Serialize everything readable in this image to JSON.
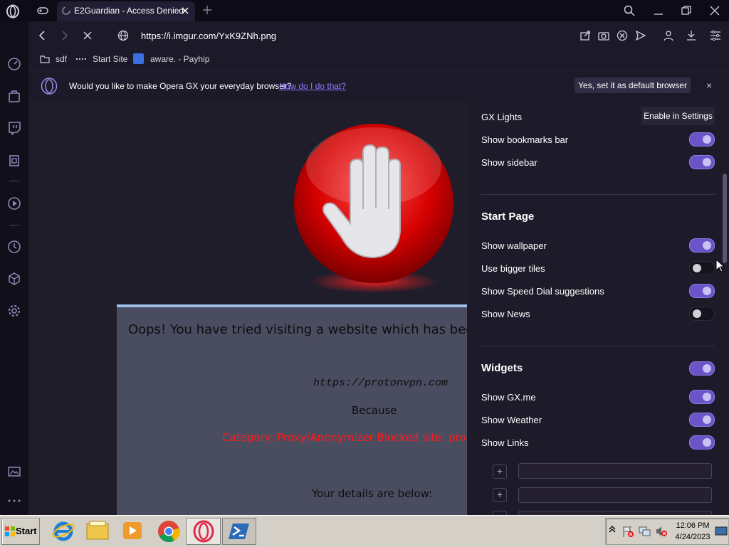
{
  "tab": {
    "title": "E2Guardian - Access Denied"
  },
  "address_bar": {
    "url": "https://i.imgur.com/YxK9ZNh.png"
  },
  "bookmarks": [
    "sdf",
    "Start Site",
    "aware. - Payhip"
  ],
  "infobar": {
    "message": "Would you like to make Opera GX your everyday browser?",
    "link": "How do I do that?",
    "button": "Yes, set it as default browser",
    "close": "×"
  },
  "page": {
    "title": "Oops! You have tried visiting a website which has been",
    "url": "https://protonvpn.com",
    "because": "Because",
    "category": "Category: Proxy/Anonymizer   Blocked site: pro",
    "details": "Your details are below:"
  },
  "panel": {
    "gx_lights": "GX Lights",
    "gx_lights_button": "Enable in Settings",
    "show_bookmarks_bar": "Show bookmarks bar",
    "show_sidebar": "Show sidebar",
    "start_page_heading": "Start Page",
    "show_wallpaper": "Show wallpaper",
    "use_bigger_tiles": "Use bigger tiles",
    "show_speed_dial": "Show Speed Dial suggestions",
    "show_news": "Show News",
    "widgets_heading": "Widgets",
    "show_gxme": "Show GX.me",
    "show_weather": "Show Weather",
    "show_links": "Show Links",
    "toggles": {
      "bookmarks_bar": true,
      "sidebar": true,
      "wallpaper": true,
      "bigger_tiles": false,
      "speed_dial": true,
      "news": false,
      "widgets": true,
      "gxme": true,
      "weather": true,
      "links": true
    }
  },
  "taskbar": {
    "start": "Start",
    "time": "12:06 PM",
    "date": "4/24/2023"
  },
  "colors": {
    "accent": "#6a54c8",
    "link": "#8f7bff",
    "error_red": "#ff1a1a"
  }
}
